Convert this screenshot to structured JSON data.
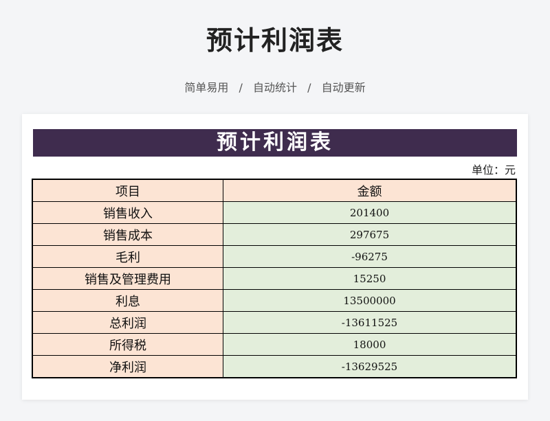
{
  "page": {
    "title": "预计利润表",
    "subtitle_parts": [
      "简单易用",
      "自动统计",
      "自动更新"
    ],
    "subtitle_separator": "/"
  },
  "sheet": {
    "banner_title": "预计利润表",
    "unit_label": "单位：元",
    "columns": [
      "项目",
      "金额"
    ],
    "rows": [
      {
        "item": "销售收入",
        "amount": "201400"
      },
      {
        "item": "销售成本",
        "amount": "297675"
      },
      {
        "item": "毛利",
        "amount": "-96275"
      },
      {
        "item": "销售及管理费用",
        "amount": "15250"
      },
      {
        "item": "利息",
        "amount": "13500000"
      },
      {
        "item": "总利润",
        "amount": "-13611525"
      },
      {
        "item": "所得税",
        "amount": "18000"
      },
      {
        "item": "净利润",
        "amount": "-13629525"
      }
    ]
  },
  "colors": {
    "banner_bg": "#3f2c4e",
    "item_cell_bg": "#fce4d4",
    "amount_cell_bg": "#e3eedb",
    "page_bg": "#f4f5f7"
  }
}
